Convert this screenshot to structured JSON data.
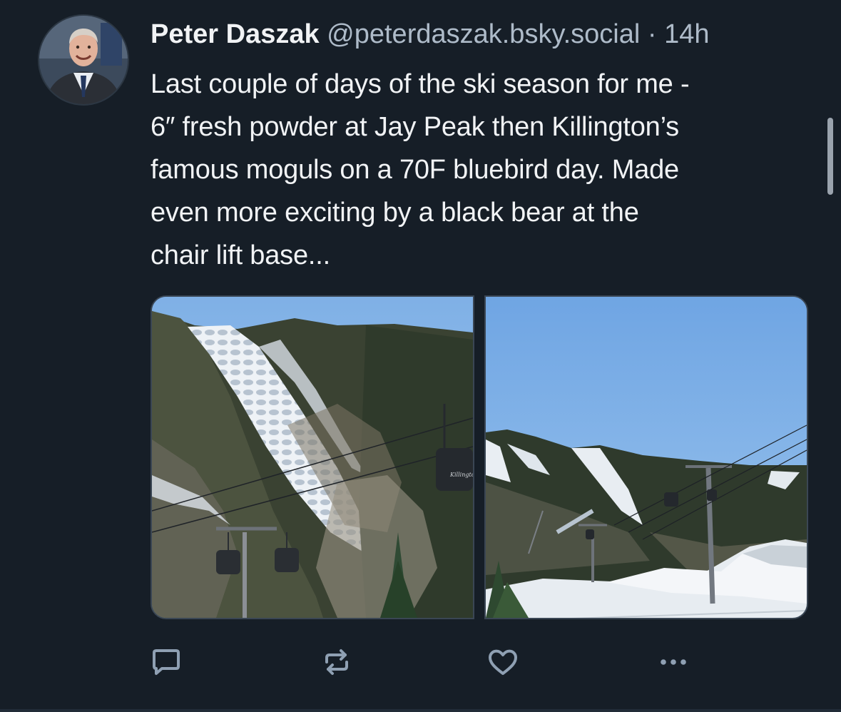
{
  "post": {
    "author_name": "Peter Daszak",
    "author_handle": "@peterdaszak.bsky.social",
    "separator": "·",
    "timestamp": "14h",
    "text_lines": [
      "Last couple of days of the ski season for me -",
      "6″ fresh powder at Jay Peak then Killington’s",
      "famous moguls on a 70F bluebird day. Made",
      "even more exciting by a black bear at the",
      "chair lift base..."
    ],
    "gondola_logo_text": "Killington"
  },
  "icons": {
    "reply": "speech-bubble-icon",
    "repost": "repost-arrows-icon",
    "like": "heart-icon",
    "more": "ellipsis-icon"
  },
  "colors": {
    "background": "#161e27",
    "text_primary": "#f1f3f5",
    "text_secondary": "#aebbc9",
    "icon": "#8fa0b3"
  }
}
